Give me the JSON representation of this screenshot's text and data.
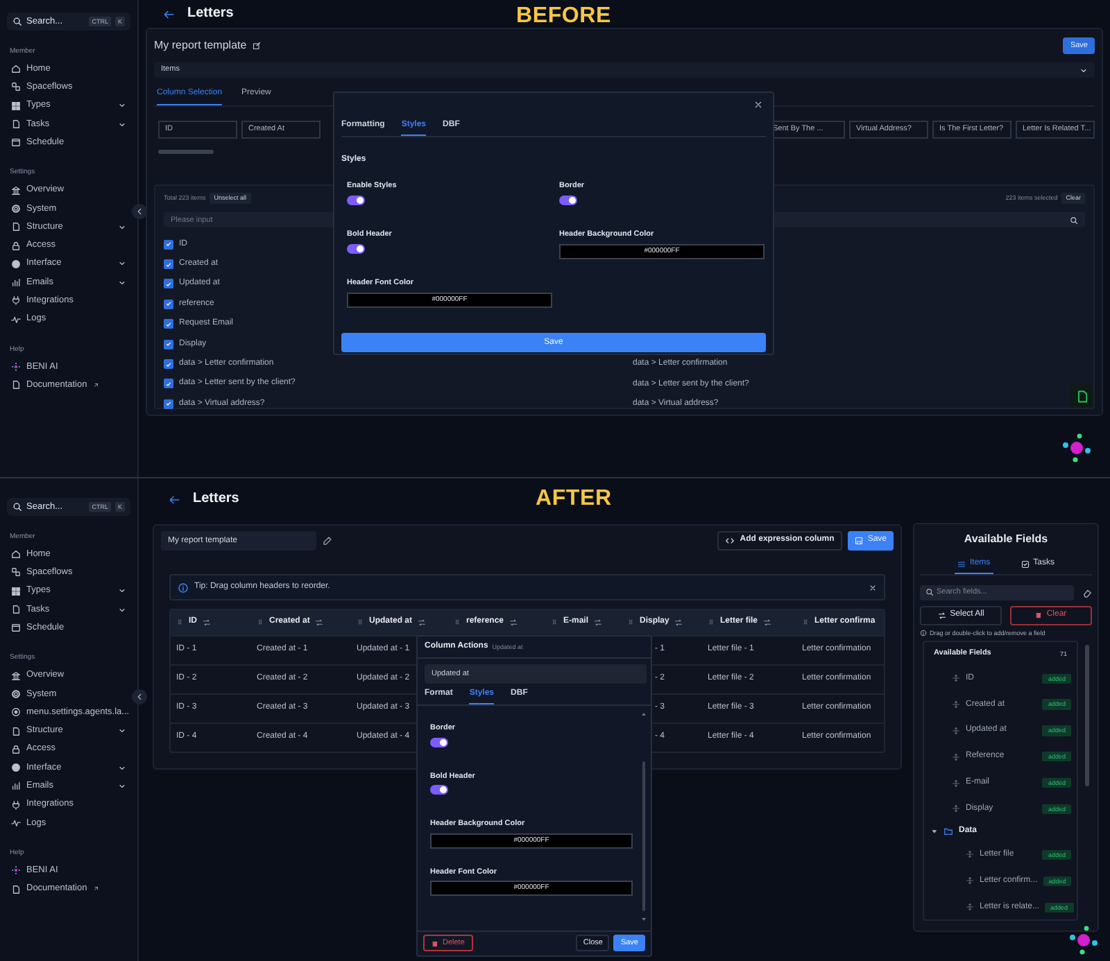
{
  "panels": [
    {
      "kind": "before",
      "banner": "BEFORE",
      "sidebar": {
        "search": {
          "placeholder": "Search...",
          "shortcut": [
            "CTRL",
            "K"
          ]
        },
        "sections": [
          {
            "title": "Member",
            "items": [
              {
                "label": "Home",
                "submenu": false
              },
              {
                "label": "Spaceflows",
                "submenu": false
              },
              {
                "label": "Types",
                "submenu": true
              },
              {
                "label": "Tasks",
                "submenu": true
              },
              {
                "label": "Schedule",
                "submenu": false
              }
            ]
          },
          {
            "title": "Settings",
            "items": [
              {
                "label": "Overview",
                "submenu": false
              },
              {
                "label": "System",
                "submenu": false
              },
              {
                "label": "Structure",
                "submenu": true
              },
              {
                "label": "Access",
                "submenu": false
              },
              {
                "label": "Interface",
                "submenu": true
              },
              {
                "label": "Emails",
                "submenu": true
              },
              {
                "label": "Integrations",
                "submenu": false
              },
              {
                "label": "Logs",
                "submenu": false
              }
            ]
          },
          {
            "title": "Help",
            "items": [
              {
                "label": "BENI AI",
                "submenu": false
              },
              {
                "label": "Documentation",
                "submenu": false
              }
            ]
          }
        ]
      },
      "page_title": "Letters",
      "report": {
        "title": "My report template",
        "save": "Save",
        "source_select": "Items",
        "tabs": [
          {
            "label": "Column Selection",
            "selected": true
          },
          {
            "label": "Preview",
            "selected": false
          }
        ],
        "column_chips": [
          "ID",
          "Created At",
          "Sent By The ...",
          "Virtual Address?",
          "Is The First Letter?",
          "Letter Is Related T..."
        ],
        "transfer": {
          "total": "Total 223 items",
          "unselect": "Unselect all",
          "selected_count": "223 items selected",
          "clear": "Clear",
          "placeholder": "Please input",
          "items": [
            {
              "label": "ID",
              "checked": true
            },
            {
              "label": "Created at",
              "checked": true
            },
            {
              "label": "Updated at",
              "checked": true
            },
            {
              "label": "reference",
              "checked": true
            },
            {
              "label": "Request Email",
              "checked": true
            },
            {
              "label": "Display",
              "checked": true
            },
            {
              "label": "data > Letter confirmation",
              "checked": true,
              "target": "data > Letter confirmation"
            },
            {
              "label": "data > Letter sent by the client?",
              "checked": true,
              "target": "data > Letter sent by the client?"
            },
            {
              "label": "data > Virtual address?",
              "checked": true,
              "target": "data > Virtual address?"
            }
          ]
        }
      },
      "dialog": {
        "tabs": [
          {
            "label": "Formatting",
            "selected": false
          },
          {
            "label": "Styles",
            "selected": true
          },
          {
            "label": "DBF",
            "selected": false
          }
        ],
        "heading": "Styles",
        "fields": [
          {
            "kind": "toggle",
            "label": "Enable Styles",
            "on": true
          },
          {
            "kind": "toggle",
            "label": "Border",
            "on": true
          },
          {
            "kind": "toggle",
            "label": "Bold Header",
            "on": true
          },
          {
            "kind": "color",
            "label": "Header Background Color",
            "value": "#000000FF"
          },
          {
            "kind": "color",
            "label": "Header Font Color",
            "value": "#000000FF"
          }
        ],
        "save": "Save"
      }
    },
    {
      "kind": "after",
      "banner": "AFTER",
      "sidebar": {
        "search": {
          "placeholder": "Search...",
          "shortcut": [
            "CTRL",
            "K"
          ]
        },
        "sections": [
          {
            "title": "Member",
            "items": [
              {
                "label": "Home",
                "submenu": false
              },
              {
                "label": "Spaceflows",
                "submenu": false
              },
              {
                "label": "Types",
                "submenu": true
              },
              {
                "label": "Tasks",
                "submenu": true
              },
              {
                "label": "Schedule",
                "submenu": false
              }
            ]
          },
          {
            "title": "Settings",
            "items": [
              {
                "label": "Overview",
                "submenu": false
              },
              {
                "label": "System",
                "submenu": false
              },
              {
                "label": "menu.settings.agents.la...",
                "submenu": false
              },
              {
                "label": "Structure",
                "submenu": true
              },
              {
                "label": "Access",
                "submenu": false
              },
              {
                "label": "Interface",
                "submenu": true
              },
              {
                "label": "Emails",
                "submenu": true
              },
              {
                "label": "Integrations",
                "submenu": false
              },
              {
                "label": "Logs",
                "submenu": false
              }
            ]
          },
          {
            "title": "Help",
            "items": [
              {
                "label": "BENI AI",
                "submenu": false
              },
              {
                "label": "Documentation",
                "submenu": false
              }
            ]
          }
        ]
      },
      "page_title": "Letters",
      "report": {
        "title_field": "My report template",
        "add_column": "Add expression column",
        "save": "Save",
        "tip": "Tip: Drag column headers to reorder.",
        "table": {
          "columns": [
            "ID",
            "Created at",
            "Updated at",
            "reference",
            "E-mail",
            "Display",
            "Letter file",
            "Letter confirma"
          ],
          "rows": [
            [
              "ID - 1",
              "Created at - 1",
              "Updated at - 1",
              null,
              null,
              "- 1",
              "Letter file - 1",
              "Letter confirmation"
            ],
            [
              "ID - 2",
              "Created at - 2",
              "Updated at - 2",
              null,
              null,
              "- 2",
              "Letter file - 2",
              "Letter confirmation"
            ],
            [
              "ID - 3",
              "Created at - 3",
              "Updated at - 3",
              null,
              null,
              "- 3",
              "Letter file - 3",
              "Letter confirmation"
            ],
            [
              "ID - 4",
              "Created at - 4",
              "Updated at - 4",
              null,
              null,
              "- 4",
              "Letter file - 4",
              "Letter confirmation"
            ]
          ]
        }
      },
      "column_menu": {
        "title": "Column Actions",
        "subtitle": "Updated at",
        "name_value": "Updated at",
        "tabs": [
          {
            "label": "Format",
            "selected": false
          },
          {
            "label": "Styles",
            "selected": true
          },
          {
            "label": "DBF",
            "selected": false
          }
        ],
        "fields": [
          {
            "kind": "toggle",
            "label": "Border",
            "on": true
          },
          {
            "kind": "toggle",
            "label": "Bold Header",
            "on": true
          },
          {
            "kind": "color",
            "label": "Header Background Color",
            "value": "#000000FF"
          },
          {
            "kind": "color",
            "label": "Header Font Color",
            "value": "#000000FF"
          }
        ],
        "delete": "Delete",
        "close": "Close",
        "save": "Save"
      },
      "fields_panel": {
        "title": "Available Fields",
        "tabs": [
          {
            "label": "Items",
            "selected": true
          },
          {
            "label": "Tasks",
            "selected": false
          }
        ],
        "search_placeholder": "Search fields...",
        "select_all": "Select All",
        "clear": "Clear",
        "hint": "Drag or double-click to add/remove a field",
        "tree_title": "Available Fields",
        "count": "71",
        "tree": [
          {
            "label": "ID",
            "badge": "added"
          },
          {
            "label": "Created at",
            "badge": "added"
          },
          {
            "label": "Updated at",
            "badge": "added"
          },
          {
            "label": "Reference",
            "badge": "added"
          },
          {
            "label": "E-mail",
            "badge": "added"
          },
          {
            "label": "Display",
            "badge": "added"
          },
          {
            "label": "Data",
            "expanded": true,
            "children": [
              {
                "label": "Letter file",
                "badge": "added"
              },
              {
                "label": "Letter confirm...",
                "badge": "added"
              },
              {
                "label": "Letter is relate...",
                "badge": "added"
              }
            ]
          }
        ]
      }
    }
  ]
}
